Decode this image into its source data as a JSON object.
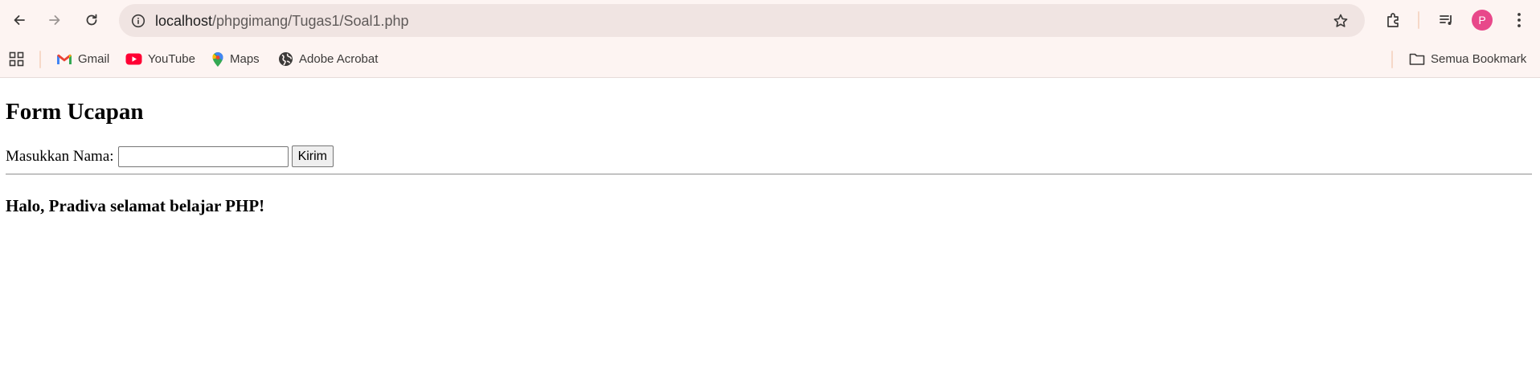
{
  "browser": {
    "url_host": "localhost",
    "url_path": "/phpgimang/Tugas1/Soal1.php",
    "profile_initial": "P",
    "icons": {
      "back": "arrow-left-icon",
      "forward": "arrow-right-icon",
      "reload": "reload-icon",
      "site_info": "info-icon",
      "bookmark_star": "star-icon",
      "extensions": "puzzle-icon",
      "media": "media-queue-icon",
      "menu": "kebab-menu-icon"
    }
  },
  "bookmarks": {
    "items": [
      {
        "label": "Gmail",
        "icon": "gmail-icon"
      },
      {
        "label": "YouTube",
        "icon": "youtube-icon"
      },
      {
        "label": "Maps",
        "icon": "maps-icon"
      },
      {
        "label": "Adobe Acrobat",
        "icon": "globe-icon"
      }
    ],
    "all_bookmarks_label": "Semua Bookmark"
  },
  "page": {
    "title": "Form Ucapan",
    "name_label": "Masukkan Nama:",
    "name_value": "",
    "submit_label": "Kirim",
    "greeting": "Halo, Pradiva selamat belajar PHP!"
  },
  "colors": {
    "toolbar_bg": "#fdf4f2",
    "omnibox_bg": "#f0e4e2",
    "avatar_bg": "#e8488a"
  }
}
